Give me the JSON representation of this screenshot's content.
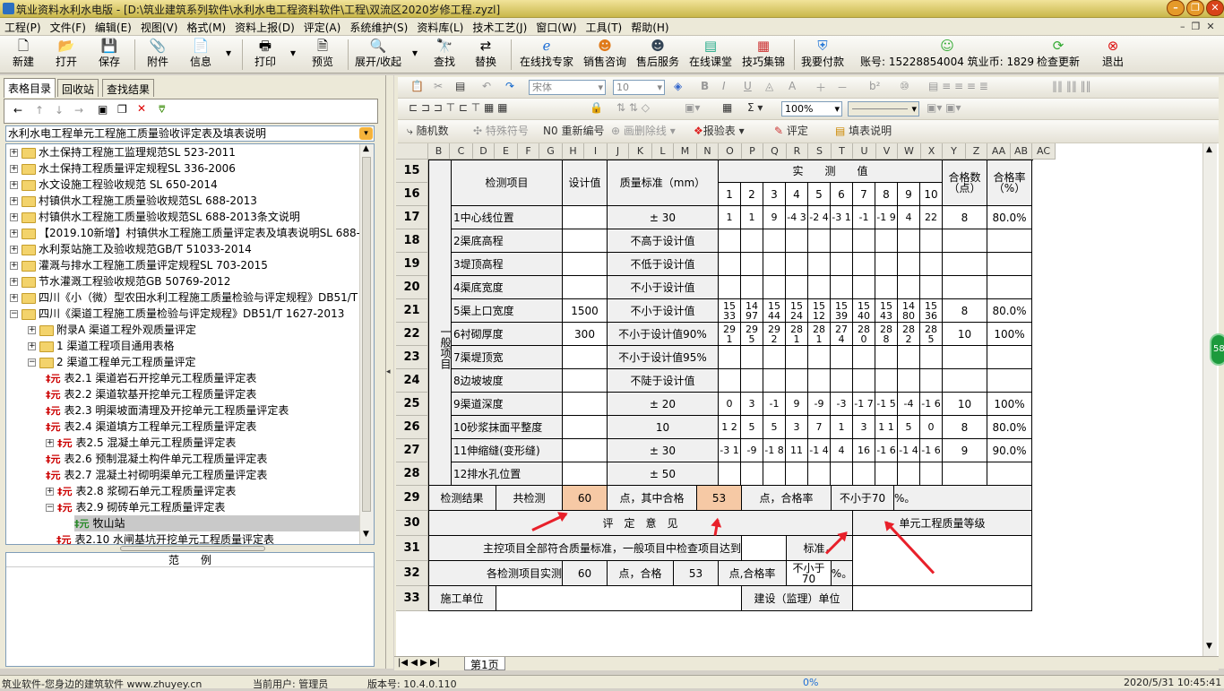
{
  "window": {
    "title": "筑业资料水利水电版 - [D:\\筑业建筑系列软件\\水利水电工程资料软件\\工程\\双流区2020岁修工程.zyzl]"
  },
  "menu": [
    "工程(P)",
    "文件(F)",
    "编辑(E)",
    "视图(V)",
    "格式(M)",
    "资料上报(D)",
    "评定(A)",
    "系统维护(S)",
    "资料库(L)",
    "技术工艺(J)",
    "窗口(W)",
    "工具(T)",
    "帮助(H)"
  ],
  "toolbar": {
    "new": "新建",
    "open": "打开",
    "save": "保存",
    "attach": "附件",
    "info": "信息",
    "print": "打印",
    "preview": "预览",
    "expand": "展开/收起",
    "find": "查找",
    "replace": "替换",
    "expert": "在线找专家",
    "sales": "销售咨询",
    "service": "售后服务",
    "classroom": "在线课堂",
    "tips": "技巧集锦",
    "pay": "我要付款",
    "account": "账号: 15228854004 筑业币: 1829",
    "update": "检查更新",
    "exit": "退出"
  },
  "left": {
    "tabs": [
      "表格目录",
      "回收站",
      "查找结果"
    ],
    "combo": "水利水电工程单元工程施工质量验收评定表及填表说明",
    "legend": "范　　例",
    "tree": [
      "水土保持工程施工监理规范SL 523-2011",
      "水土保持工程质量评定规程SL 336-2006",
      "水文设施工程验收规范 SL 650-2014",
      "村镇供水工程施工质量验收规范SL 688-2013",
      "村镇供水工程施工质量验收规范SL 688-2013条文说明",
      "【2019.10新增】村镇供水工程施工质量评定表及填表说明SL 688-2",
      "水利泵站施工及验收规范GB/T 51033-2014",
      "灌溉与排水工程施工质量评定规程SL 703-2015",
      "节水灌溉工程验收规范GB 50769-2012",
      "四川《小（微）型农田水利工程施工质量检验与评定规程》DB51/T",
      "四川《渠道工程施工质量检验与评定规程》DB51/T 1627-2013",
      "附录A 渠道工程外观质量评定",
      "1 渠道工程项目通用表格",
      "2 渠道工程单元工程质量评定",
      "表2.1 渠道岩石开挖单元工程质量评定表",
      "表2.2 渠道软基开挖单元工程质量评定表",
      "表2.3 明渠坡面清理及开挖单元工程质量评定表",
      "表2.4 渠道填方工程单元工程质量评定表",
      "表2.5 混凝土单元工程质量评定表",
      "表2.6 预制混凝土构件单元工程质量评定表",
      "表2.7 混凝土衬砌明渠单元工程质量评定表",
      "表2.8 浆砌石单元工程质量评定表",
      "表2.9 砌砖单元工程质量评定表",
      "牧山站",
      "表2.10 水闸基坑开挖单元工程质量评定表"
    ]
  },
  "format": {
    "font": "宋体",
    "size": "10",
    "zoom": "100%",
    "r1": [
      "随机数",
      "特殊符号",
      "重新编号",
      "画删除线",
      "报验表",
      "评定",
      "填表说明"
    ]
  },
  "sheet": {
    "cols": [
      "B",
      "C",
      "D",
      "E",
      "F",
      "G",
      "H",
      "I",
      "J",
      "K",
      "L",
      "M",
      "N",
      "O",
      "P",
      "Q",
      "R",
      "S",
      "T",
      "U",
      "V",
      "W",
      "X",
      "Y",
      "Z",
      "AA",
      "AB",
      "AC"
    ],
    "rownums": [
      "15",
      "16",
      "17",
      "18",
      "19",
      "20",
      "21",
      "22",
      "23",
      "24",
      "25",
      "26",
      "27",
      "28",
      "29",
      "30",
      "31",
      "32",
      "33"
    ],
    "hdr": {
      "item": "检测项目",
      "design": "设计值",
      "std": "质量标准（mm）",
      "measured": "实　　测　　值",
      "pass_n": "合格数（点）",
      "rate": "合格率（%）",
      "general": "一般项目",
      "n": [
        "1",
        "2",
        "3",
        "4",
        "5",
        "6",
        "7",
        "8",
        "9",
        "10"
      ]
    },
    "rows": [
      {
        "item": "1中心线位置",
        "design": "",
        "std": "± 30",
        "v": [
          "1",
          "1",
          "9",
          "-4 3",
          "-2 4",
          "-3 1",
          "-1",
          "-1 9",
          "4",
          "22"
        ],
        "pn": "8",
        "rate": "80.0%"
      },
      {
        "item": "2渠底高程",
        "design": "",
        "std": "不高于设计值",
        "v": [
          "",
          "",
          "",
          "",
          "",
          "",
          "",
          "",
          "",
          ""
        ],
        "pn": "",
        "rate": ""
      },
      {
        "item": "3堤顶高程",
        "design": "",
        "std": "不低于设计值",
        "v": [
          "",
          "",
          "",
          "",
          "",
          "",
          "",
          "",
          "",
          ""
        ],
        "pn": "",
        "rate": ""
      },
      {
        "item": "4渠底宽度",
        "design": "",
        "std": "不小于设计值",
        "v": [
          "",
          "",
          "",
          "",
          "",
          "",
          "",
          "",
          "",
          ""
        ],
        "pn": "",
        "rate": ""
      },
      {
        "item": "5渠上口宽度",
        "design": "1500",
        "std": "不小于设计值",
        "v": [
          "15 33",
          "14 97",
          "15 44",
          "15 24",
          "15 12",
          "15 39",
          "15 40",
          "15 43",
          "14 80",
          "15 36"
        ],
        "pn": "8",
        "rate": "80.0%"
      },
      {
        "item": "6衬砌厚度",
        "design": "300",
        "std": "不小于设计值90%",
        "v": [
          "29 1",
          "29 5",
          "29 2",
          "28 1",
          "28 1",
          "27 4",
          "28 0",
          "28 8",
          "28 2",
          "28 5"
        ],
        "pn": "10",
        "rate": "100%"
      },
      {
        "item": "7渠堤顶宽",
        "design": "",
        "std": "不小于设计值95%",
        "v": [
          "",
          "",
          "",
          "",
          "",
          "",
          "",
          "",
          "",
          ""
        ],
        "pn": "",
        "rate": ""
      },
      {
        "item": "8边坡坡度",
        "design": "",
        "std": "不陡于设计值",
        "v": [
          "",
          "",
          "",
          "",
          "",
          "",
          "",
          "",
          "",
          ""
        ],
        "pn": "",
        "rate": ""
      },
      {
        "item": "9渠道深度",
        "design": "",
        "std": "± 20",
        "v": [
          "0",
          "3",
          "-1",
          "9",
          "-9",
          "-3",
          "-1 7",
          "-1 5",
          "-4",
          "-1 6"
        ],
        "pn": "10",
        "rate": "100%"
      },
      {
        "item": "10砂浆抹面平整度",
        "design": "",
        "std": "10",
        "v": [
          "1 2",
          "5",
          "5",
          "3",
          "7",
          "1",
          "3",
          "1 1",
          "5",
          "0"
        ],
        "pn": "8",
        "rate": "80.0%"
      },
      {
        "item": "11伸缩缝(变形缝)",
        "design": "",
        "std": "± 30",
        "v": [
          "-3 1",
          "-9",
          "-1 8",
          "11",
          "-1 4",
          "4",
          "16",
          "-1 6",
          "-1 4",
          "-1 6"
        ],
        "pn": "9",
        "rate": "90.0%"
      },
      {
        "item": "12排水孔位置",
        "design": "",
        "std": "± 50",
        "v": [
          "",
          "",
          "",
          "",
          "",
          "",
          "",
          "",
          "",
          ""
        ],
        "pn": "",
        "rate": ""
      }
    ],
    "r29": {
      "a": "检测结果",
      "b": "共检测",
      "n": "60",
      "c": "点，其中合格",
      "p": "53",
      "d": "点，合格率",
      "e": "不小于70",
      "f": "%。"
    },
    "r30": {
      "a": "评　定　意　见",
      "b": "单元工程质量等级"
    },
    "r31": {
      "a": "主控项目全部符合质量标准，一般项目中检查项目达到",
      "b": "标准，"
    },
    "r32": {
      "a": "各检测项目实测",
      "n": "60",
      "b": "点，合格",
      "p": "53",
      "c": "点,合格率",
      "e": "不小于70",
      "d": "%。"
    },
    "r33": {
      "a": "施工单位",
      "b": "建设（监理）单位"
    }
  },
  "sheettab": "第1页",
  "status": {
    "a": "筑业软件-您身边的建筑软件 www.zhuyey.cn",
    "user": "当前用户: 管理员",
    "ver": "版本号: 10.4.0.110",
    "pct": "0%",
    "time": "2020/5/31 10:45:41"
  },
  "colors": {
    "accent": "#f6c9a5",
    "arrow": "#e8202a"
  }
}
